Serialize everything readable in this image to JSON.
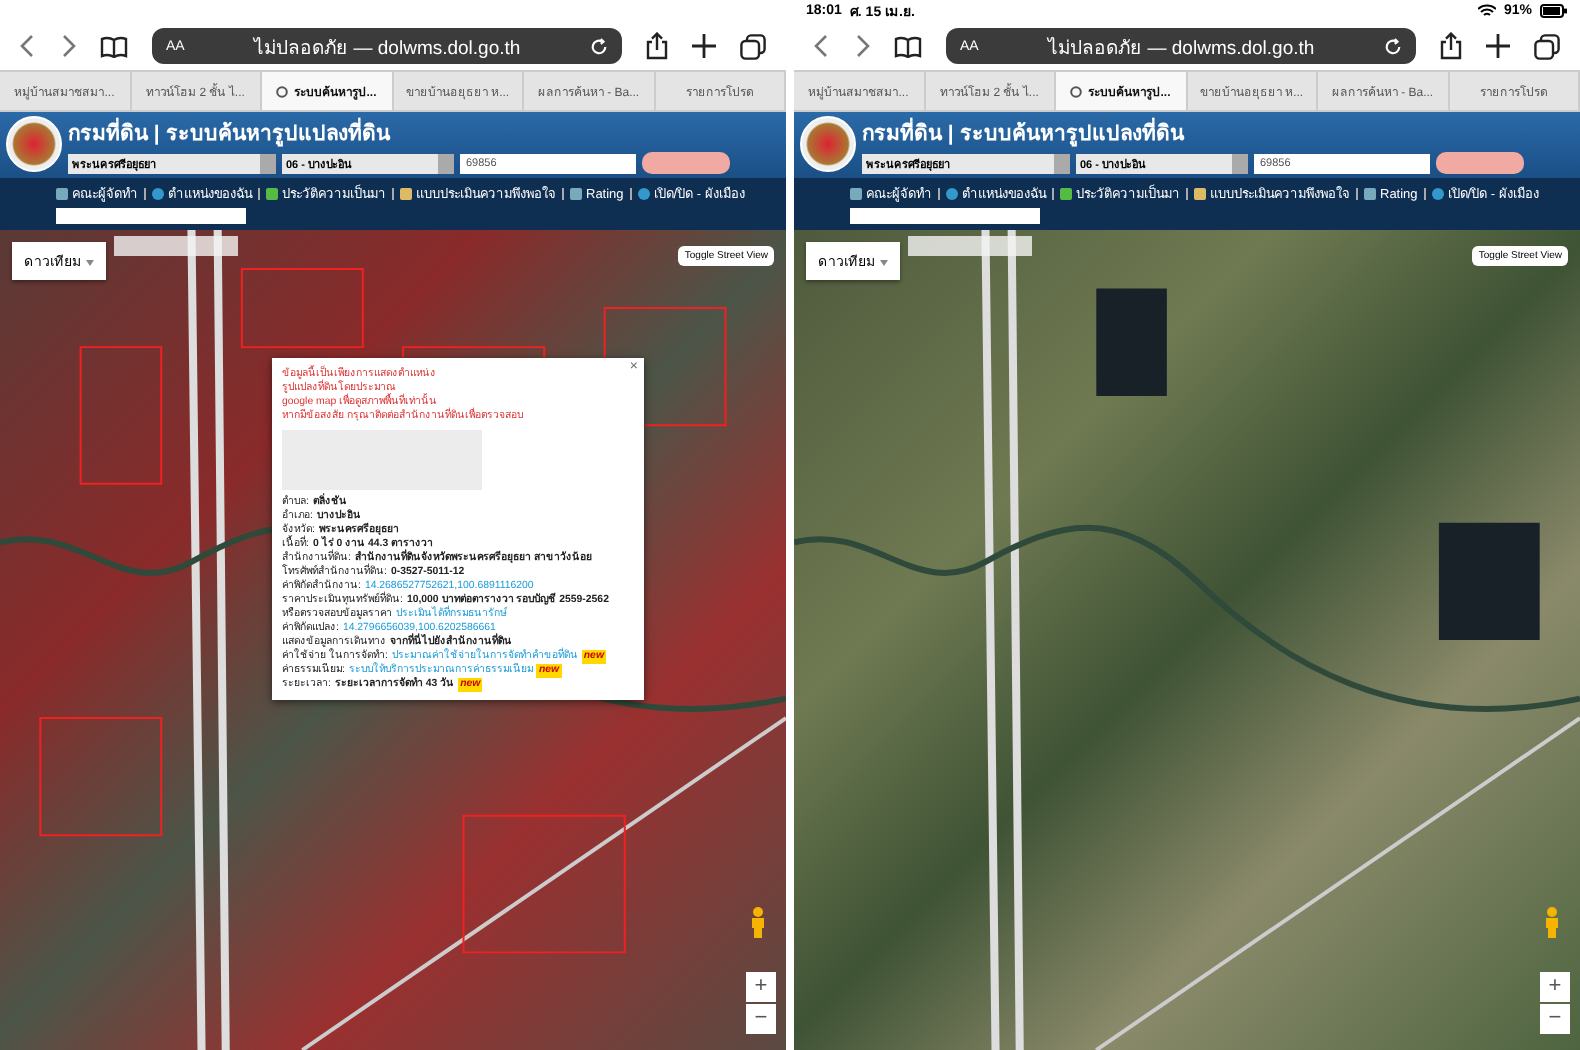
{
  "panels": [
    {
      "address": {
        "aa": "AA",
        "url": "ไม่ปลอดภัย — dolwms.dol.go.th"
      },
      "tabs": [
        {
          "label": "หมู่บ้านสมาชสมา...",
          "selected": false
        },
        {
          "label": "ทาวน์โฮม 2 ชั้น ไ...",
          "selected": false
        },
        {
          "label": "ระบบค้นหารูป...",
          "selected": true
        },
        {
          "label": "ขายบ้านอยุธยา ห...",
          "selected": false
        },
        {
          "label": "ผลการค้นหา - Ba...",
          "selected": false
        },
        {
          "label": "รายการโปรด",
          "selected": false
        }
      ],
      "header": {
        "title": "กรมที่ดิน | ระบบค้นหารูปแปลงที่ดิน",
        "province": "พระนครศรีอยุธยา",
        "district": "06 - บางปะอิน",
        "parcel": "69856"
      },
      "menu": [
        "คณะผู้จัดทำ",
        "ตำแหน่งของฉัน",
        "ประวัติความเป็นมา",
        "แบบประเมินความพึงพอใจ",
        "Rating",
        "เปิด/ปิด - ผังเมือง"
      ],
      "map": {
        "kind": "infrared",
        "map_type": "ดาวเทียม",
        "street_view": "Toggle Street View",
        "zoom_in": "+",
        "zoom_out": "−",
        "popup": {
          "close": "×",
          "lines": [
            {
              "kind": "notice",
              "text": "ข้อมูลนี้เป็นเพียงการแสดงตำแหน่ง"
            },
            {
              "kind": "notice",
              "text": "รูปแปลงที่ดินโดยประมาณ"
            },
            {
              "kind": "notice",
              "text": "google map เพื่อดูสภาพพื้นที่เท่านั้น"
            },
            {
              "kind": "notice",
              "text": "หากมีข้อสงสัย กรุณาติดต่อสำนักงานที่ดินเพื่อตรวจสอบ"
            },
            {
              "kind": "photo"
            },
            {
              "kind": "field",
              "label": "ตำบล:",
              "value": "ตลิ่งชัน"
            },
            {
              "kind": "field",
              "label": "อำเภอ:",
              "value": "บางปะอิน"
            },
            {
              "kind": "field",
              "label": "จังหวัด:",
              "value": "พระนครศรีอยุธยา"
            },
            {
              "kind": "field",
              "label": "เนื้อที่:",
              "value": "0 ไร่ 0 งาน 44.3 ตารางวา"
            },
            {
              "kind": "field",
              "label": "สำนักงานที่ดิน:",
              "value": "สำนักงานที่ดินจังหวัดพระนครศรีอยุธยา สาขาวังน้อย"
            },
            {
              "kind": "field",
              "label": "โทรศัพท์สำนักงานที่ดิน:",
              "value": "0-3527-5011-12"
            },
            {
              "kind": "link",
              "label": "ค่าพิกัดสำนักงาน:",
              "value": "14.2686527752621,100.6891116200"
            },
            {
              "kind": "field",
              "label": "ราคาประเมินทุนทรัพย์ที่ดิน:",
              "value": "10,000 บาทต่อตารางวา รอบบัญชี 2559-2562"
            },
            {
              "kind": "link",
              "label": "หรือตรวจสอบข้อมูลราคา",
              "value": "ประเมินได้ที่กรมธนารักษ์"
            },
            {
              "kind": "link",
              "label": "ค่าพิกัดแปลง:",
              "value": "14.2796656039,100.6202586661"
            },
            {
              "kind": "field",
              "label": "แสดงข้อมูลการเดินทาง",
              "value": "จากที่นี่ไปยังสำนักงานที่ดิน"
            },
            {
              "kind": "link",
              "label": "ค่าใช้จ่าย ในการจัดทำ:",
              "value": "ประมาณค่าใช้จ่ายในการจัดทำคำขอที่ดิน",
              "badge": "new"
            },
            {
              "kind": "link",
              "label": "ค่าธรรมเนียม:",
              "value": "ระบบให้บริการประมาณการค่าธรรมเนียม",
              "badge": "new"
            },
            {
              "kind": "field",
              "label": "ระยะเวลา:",
              "value": "ระยะเวลาการจัดทำ 43 วัน",
              "badge": "new"
            }
          ]
        }
      }
    },
    {
      "status_bar": {
        "time": "18:01",
        "date": "ศ. 15 เม.ย.",
        "battery": "91%"
      },
      "address": {
        "aa": "AA",
        "url": "ไม่ปลอดภัย — dolwms.dol.go.th"
      },
      "tabs": [
        {
          "label": "หมู่บ้านสมาชสมา...",
          "selected": false
        },
        {
          "label": "ทาวน์โฮม 2 ชั้น ไ...",
          "selected": false
        },
        {
          "label": "ระบบค้นหารูป...",
          "selected": true
        },
        {
          "label": "ขายบ้านอยุธยา ห...",
          "selected": false
        },
        {
          "label": "ผลการค้นหา - Ba...",
          "selected": false
        },
        {
          "label": "รายการโปรด",
          "selected": false
        }
      ],
      "header": {
        "title": "กรมที่ดิน | ระบบค้นหารูปแปลงที่ดิน",
        "province": "พระนครศรีอยุธยา",
        "district": "06 - บางปะอิน",
        "parcel": "69856"
      },
      "menu": [
        "คณะผู้จัดทำ",
        "ตำแหน่งของฉัน",
        "ประวัติความเป็นมา",
        "แบบประเมินความพึงพอใจ",
        "Rating",
        "เปิด/ปิด - ผังเมือง"
      ],
      "map": {
        "kind": "true_color",
        "map_type": "ดาวเทียม",
        "street_view": "Toggle Street View",
        "zoom_in": "+",
        "zoom_out": "−"
      }
    }
  ]
}
